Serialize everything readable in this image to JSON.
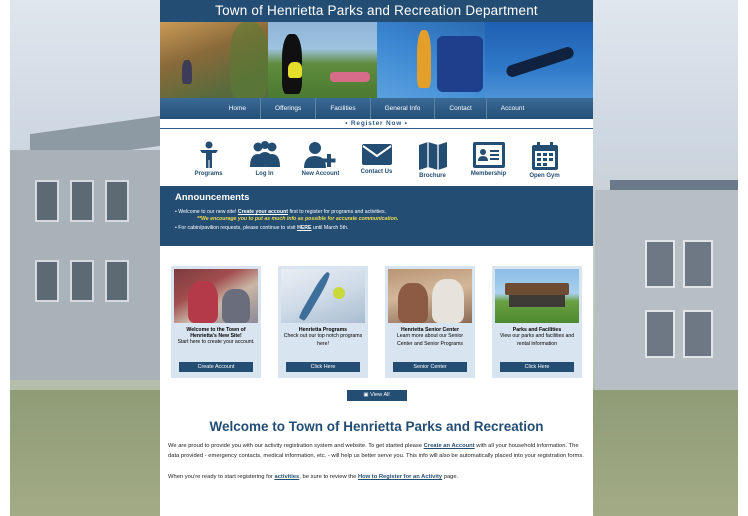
{
  "site": {
    "title": "Town of Henrietta Parks and Recreation Department"
  },
  "nav": {
    "items": [
      "Home",
      "Offerings",
      "Facilities",
      "General Info",
      "Contact",
      "Account"
    ]
  },
  "register_now": "• Register Now •",
  "quick_links": [
    {
      "label": "Programs",
      "icon": "person-icon"
    },
    {
      "label": "Log In",
      "icon": "group-icon"
    },
    {
      "label": "New Account",
      "icon": "add-user-icon"
    },
    {
      "label": "Contact Us",
      "icon": "envelope-icon"
    },
    {
      "label": "Brochure",
      "icon": "map-icon"
    },
    {
      "label": "Membership",
      "icon": "id-card-icon"
    },
    {
      "label": "Open Gym",
      "icon": "calendar-icon"
    }
  ],
  "announcements": {
    "title": "Announcements",
    "line1_pre": "Welcome to our new site! ",
    "line1_link": "Create your account",
    "line1_post": " first to register for programs and activities.",
    "line1_warning": "**We encourage you to put as much info as possible for accurate communication.",
    "line2_pre": "For cabin/pavilion requests, please continue to visit ",
    "line2_link": "HERE",
    "line2_post": " until March 5th."
  },
  "cards": [
    {
      "title": "Welcome to the Town of Henrietta's New Site!",
      "desc": "Start here to create your account.",
      "button": "Create Account"
    },
    {
      "title": "Henrietta Programs",
      "desc": "Check out our top notch programs here!",
      "button": "Click Here"
    },
    {
      "title": "Henrietta Senior Center",
      "desc": "Learn more about our Senior Center and Senior Programs",
      "button": "Senior Center"
    },
    {
      "title": "Parks and Facilities",
      "desc": "View our parks and facilities and rental information",
      "button": "Click Here"
    }
  ],
  "view_all": "View All",
  "welcome": {
    "title": "Welcome to Town of Henrietta Parks and Recreation",
    "p1_pre": "We are proud to provide you with our activity registration system and website. To get started please ",
    "p1_link": "Create an Account",
    "p1_post": " with all your household information. The data provided - emergency contacts, medical information, etc. - will help us better serve you. This info will also be automatically placed into your registration forms.",
    "p2_pre": "When you're ready to start registering for ",
    "p2_link1": "activities",
    "p2_mid": ", be sure to review the ",
    "p2_link2": "How to Register for an Activity",
    "p2_post": " page."
  },
  "colors": {
    "brand": "#244d73",
    "warning": "#f5df4d",
    "card_bg": "#d8e4ef"
  }
}
